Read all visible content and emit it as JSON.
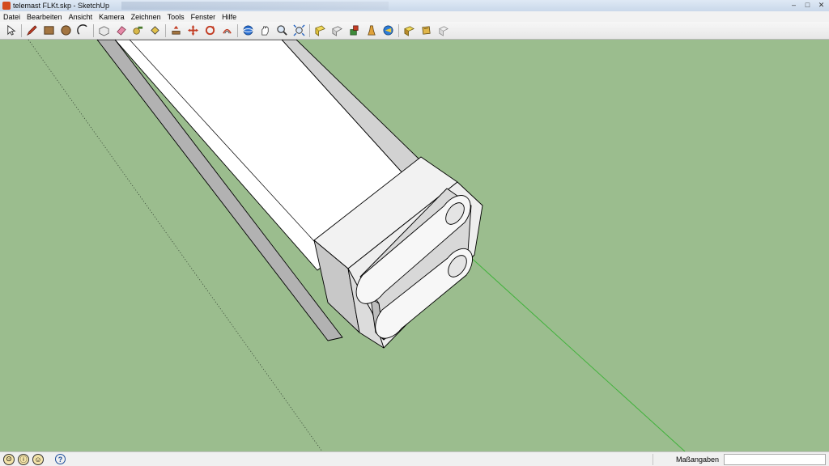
{
  "window": {
    "title": "telemast FLKt.skp - SketchUp",
    "controls": {
      "minimize": "–",
      "maximize": "□",
      "close": "✕"
    }
  },
  "menubar": {
    "items": [
      "Datei",
      "Bearbeiten",
      "Ansicht",
      "Kamera",
      "Zeichnen",
      "Tools",
      "Fenster",
      "Hilfe"
    ]
  },
  "toolbar": {
    "groups": [
      [
        "select-icon"
      ],
      [
        "pencil-icon",
        "rectangle-icon",
        "circle-icon",
        "arc-icon"
      ],
      [
        "make-component-icon",
        "eraser-icon",
        "tape-measure-icon",
        "paint-bucket-icon"
      ],
      [
        "push-pull-icon",
        "move-icon",
        "rotate-icon",
        "offset-icon"
      ],
      [
        "orbit-icon",
        "pan-icon",
        "zoom-icon",
        "zoom-extents-icon"
      ],
      [
        "get-models-icon",
        "share-model-icon",
        "get-components-icon",
        "share-component-icon",
        "extension-warehouse-icon"
      ],
      [
        "layout-icon",
        "style-builder-icon",
        "send-layout-icon"
      ]
    ],
    "accent": "#1f5fbf"
  },
  "viewport": {
    "background": "#9bbd8e",
    "axis_colors": {
      "green": "#3fb23a",
      "dotted": "#3a4a38"
    }
  },
  "statusbar": {
    "icons": [
      "geo-location-icon",
      "credits-icon",
      "user-icon"
    ],
    "help_icon": "?",
    "status_text": "",
    "measurements_label": "Maßangaben",
    "measurements_value": ""
  }
}
